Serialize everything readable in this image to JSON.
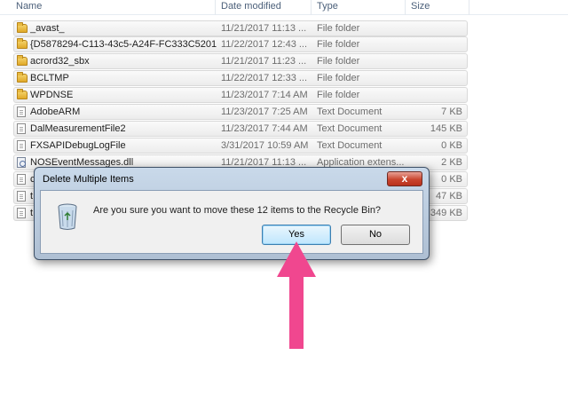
{
  "columns": [
    {
      "label": "Name"
    },
    {
      "label": "Date modified"
    },
    {
      "label": "Type"
    },
    {
      "label": "Size"
    }
  ],
  "files": [
    {
      "name": "_avast_",
      "date": "11/21/2017 11:13 ...",
      "type": "File folder",
      "size": "",
      "icon": "folder-icon"
    },
    {
      "name": "{D5878294-C113-43c5-A24F-FC333C5201...",
      "date": "11/22/2017 12:43 ...",
      "type": "File folder",
      "size": "",
      "icon": "folder-icon"
    },
    {
      "name": "acrord32_sbx",
      "date": "11/21/2017 11:23 ...",
      "type": "File folder",
      "size": "",
      "icon": "folder-icon"
    },
    {
      "name": "BCLTMP",
      "date": "11/22/2017 12:33 ...",
      "type": "File folder",
      "size": "",
      "icon": "folder-icon"
    },
    {
      "name": "WPDNSE",
      "date": "11/23/2017 7:14 AM",
      "type": "File folder",
      "size": "",
      "icon": "folder-icon"
    },
    {
      "name": "AdobeARM",
      "date": "11/23/2017 7:25 AM",
      "type": "Text Document",
      "size": "7 KB",
      "icon": "text-document-icon"
    },
    {
      "name": "DalMeasurementFile2",
      "date": "11/23/2017 7:44 AM",
      "type": "Text Document",
      "size": "145 KB",
      "icon": "text-document-icon"
    },
    {
      "name": "FXSAPIDebugLogFile",
      "date": "3/31/2017 10:59 AM",
      "type": "Text Document",
      "size": "0 KB",
      "icon": "text-document-icon"
    },
    {
      "name": "NOSEventMessages.dll",
      "date": "11/21/2017 11:13 ...",
      "type": "Application extens...",
      "size": "2 KB",
      "icon": "dll-icon"
    },
    {
      "name": "c",
      "date": "",
      "type": "",
      "size": "0 KB",
      "icon": "text-document-icon"
    },
    {
      "name": "t",
      "date": "",
      "type": "",
      "size": "47 KB",
      "icon": "text-document-icon"
    },
    {
      "name": "t",
      "date": "",
      "type": "",
      "size": "349 KB",
      "icon": "text-document-icon"
    }
  ],
  "dialog": {
    "title": "Delete Multiple Items",
    "close_label": "x",
    "message": "Are you sure you want to move these 12 items to the Recycle Bin?",
    "yes_label": "Yes",
    "no_label": "No",
    "icon": "recycle-bin-icon"
  },
  "annotation": {
    "icon": "pointer-arrow-icon",
    "color": "#f0478f"
  }
}
